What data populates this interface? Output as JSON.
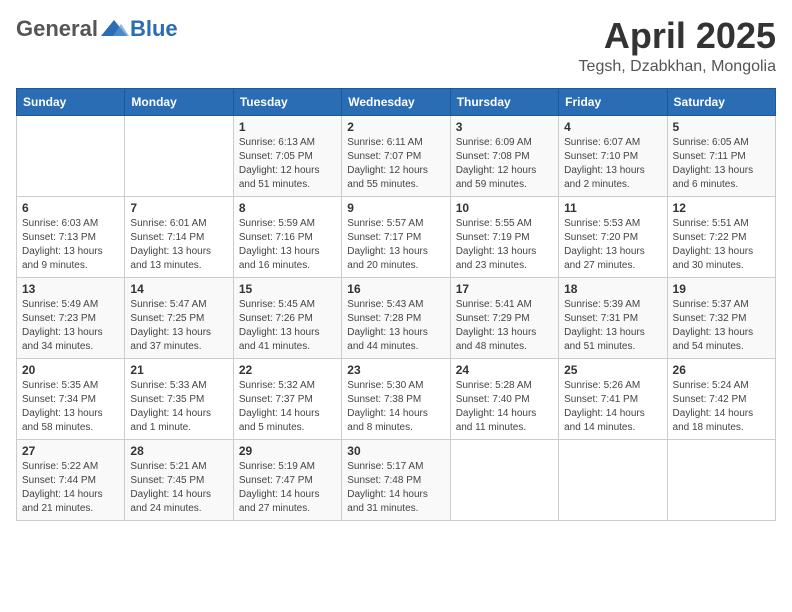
{
  "header": {
    "logo": {
      "general": "General",
      "blue": "Blue"
    },
    "title": "April 2025",
    "location": "Tegsh, Dzabkhan, Mongolia"
  },
  "weekdays": [
    "Sunday",
    "Monday",
    "Tuesday",
    "Wednesday",
    "Thursday",
    "Friday",
    "Saturday"
  ],
  "weeks": [
    [
      null,
      null,
      {
        "day": "1",
        "sunrise": "Sunrise: 6:13 AM",
        "sunset": "Sunset: 7:05 PM",
        "daylight": "Daylight: 12 hours and 51 minutes."
      },
      {
        "day": "2",
        "sunrise": "Sunrise: 6:11 AM",
        "sunset": "Sunset: 7:07 PM",
        "daylight": "Daylight: 12 hours and 55 minutes."
      },
      {
        "day": "3",
        "sunrise": "Sunrise: 6:09 AM",
        "sunset": "Sunset: 7:08 PM",
        "daylight": "Daylight: 12 hours and 59 minutes."
      },
      {
        "day": "4",
        "sunrise": "Sunrise: 6:07 AM",
        "sunset": "Sunset: 7:10 PM",
        "daylight": "Daylight: 13 hours and 2 minutes."
      },
      {
        "day": "5",
        "sunrise": "Sunrise: 6:05 AM",
        "sunset": "Sunset: 7:11 PM",
        "daylight": "Daylight: 13 hours and 6 minutes."
      }
    ],
    [
      {
        "day": "6",
        "sunrise": "Sunrise: 6:03 AM",
        "sunset": "Sunset: 7:13 PM",
        "daylight": "Daylight: 13 hours and 9 minutes."
      },
      {
        "day": "7",
        "sunrise": "Sunrise: 6:01 AM",
        "sunset": "Sunset: 7:14 PM",
        "daylight": "Daylight: 13 hours and 13 minutes."
      },
      {
        "day": "8",
        "sunrise": "Sunrise: 5:59 AM",
        "sunset": "Sunset: 7:16 PM",
        "daylight": "Daylight: 13 hours and 16 minutes."
      },
      {
        "day": "9",
        "sunrise": "Sunrise: 5:57 AM",
        "sunset": "Sunset: 7:17 PM",
        "daylight": "Daylight: 13 hours and 20 minutes."
      },
      {
        "day": "10",
        "sunrise": "Sunrise: 5:55 AM",
        "sunset": "Sunset: 7:19 PM",
        "daylight": "Daylight: 13 hours and 23 minutes."
      },
      {
        "day": "11",
        "sunrise": "Sunrise: 5:53 AM",
        "sunset": "Sunset: 7:20 PM",
        "daylight": "Daylight: 13 hours and 27 minutes."
      },
      {
        "day": "12",
        "sunrise": "Sunrise: 5:51 AM",
        "sunset": "Sunset: 7:22 PM",
        "daylight": "Daylight: 13 hours and 30 minutes."
      }
    ],
    [
      {
        "day": "13",
        "sunrise": "Sunrise: 5:49 AM",
        "sunset": "Sunset: 7:23 PM",
        "daylight": "Daylight: 13 hours and 34 minutes."
      },
      {
        "day": "14",
        "sunrise": "Sunrise: 5:47 AM",
        "sunset": "Sunset: 7:25 PM",
        "daylight": "Daylight: 13 hours and 37 minutes."
      },
      {
        "day": "15",
        "sunrise": "Sunrise: 5:45 AM",
        "sunset": "Sunset: 7:26 PM",
        "daylight": "Daylight: 13 hours and 41 minutes."
      },
      {
        "day": "16",
        "sunrise": "Sunrise: 5:43 AM",
        "sunset": "Sunset: 7:28 PM",
        "daylight": "Daylight: 13 hours and 44 minutes."
      },
      {
        "day": "17",
        "sunrise": "Sunrise: 5:41 AM",
        "sunset": "Sunset: 7:29 PM",
        "daylight": "Daylight: 13 hours and 48 minutes."
      },
      {
        "day": "18",
        "sunrise": "Sunrise: 5:39 AM",
        "sunset": "Sunset: 7:31 PM",
        "daylight": "Daylight: 13 hours and 51 minutes."
      },
      {
        "day": "19",
        "sunrise": "Sunrise: 5:37 AM",
        "sunset": "Sunset: 7:32 PM",
        "daylight": "Daylight: 13 hours and 54 minutes."
      }
    ],
    [
      {
        "day": "20",
        "sunrise": "Sunrise: 5:35 AM",
        "sunset": "Sunset: 7:34 PM",
        "daylight": "Daylight: 13 hours and 58 minutes."
      },
      {
        "day": "21",
        "sunrise": "Sunrise: 5:33 AM",
        "sunset": "Sunset: 7:35 PM",
        "daylight": "Daylight: 14 hours and 1 minute."
      },
      {
        "day": "22",
        "sunrise": "Sunrise: 5:32 AM",
        "sunset": "Sunset: 7:37 PM",
        "daylight": "Daylight: 14 hours and 5 minutes."
      },
      {
        "day": "23",
        "sunrise": "Sunrise: 5:30 AM",
        "sunset": "Sunset: 7:38 PM",
        "daylight": "Daylight: 14 hours and 8 minutes."
      },
      {
        "day": "24",
        "sunrise": "Sunrise: 5:28 AM",
        "sunset": "Sunset: 7:40 PM",
        "daylight": "Daylight: 14 hours and 11 minutes."
      },
      {
        "day": "25",
        "sunrise": "Sunrise: 5:26 AM",
        "sunset": "Sunset: 7:41 PM",
        "daylight": "Daylight: 14 hours and 14 minutes."
      },
      {
        "day": "26",
        "sunrise": "Sunrise: 5:24 AM",
        "sunset": "Sunset: 7:42 PM",
        "daylight": "Daylight: 14 hours and 18 minutes."
      }
    ],
    [
      {
        "day": "27",
        "sunrise": "Sunrise: 5:22 AM",
        "sunset": "Sunset: 7:44 PM",
        "daylight": "Daylight: 14 hours and 21 minutes."
      },
      {
        "day": "28",
        "sunrise": "Sunrise: 5:21 AM",
        "sunset": "Sunset: 7:45 PM",
        "daylight": "Daylight: 14 hours and 24 minutes."
      },
      {
        "day": "29",
        "sunrise": "Sunrise: 5:19 AM",
        "sunset": "Sunset: 7:47 PM",
        "daylight": "Daylight: 14 hours and 27 minutes."
      },
      {
        "day": "30",
        "sunrise": "Sunrise: 5:17 AM",
        "sunset": "Sunset: 7:48 PM",
        "daylight": "Daylight: 14 hours and 31 minutes."
      },
      null,
      null,
      null
    ]
  ]
}
